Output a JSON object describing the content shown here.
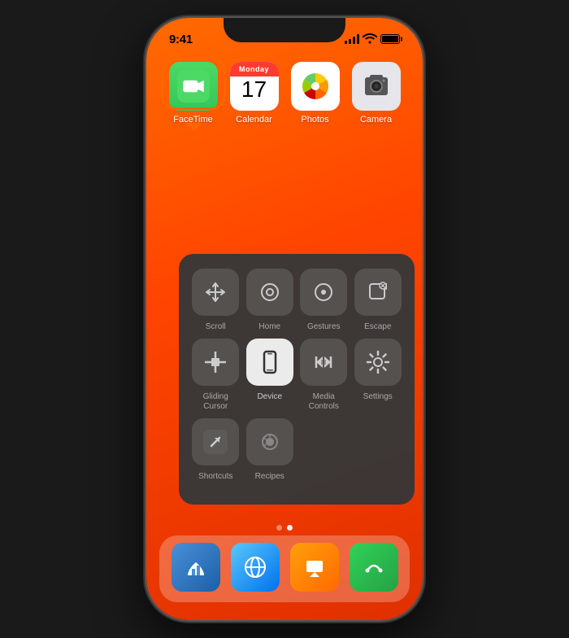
{
  "phone": {
    "status_bar": {
      "time": "9:41",
      "signal_full": true,
      "wifi": true,
      "battery_full": true
    },
    "home_screen": {
      "row1": [
        {
          "id": "facetime",
          "label": "FaceTime",
          "highlighted": true
        },
        {
          "id": "calendar",
          "label": "Calendar",
          "day": "Monday",
          "date": "17"
        },
        {
          "id": "photos",
          "label": "Photos"
        },
        {
          "id": "camera",
          "label": "Camera"
        }
      ]
    },
    "assistive_panel": {
      "row1": [
        {
          "id": "scroll",
          "label": "Scroll"
        },
        {
          "id": "home",
          "label": "Home"
        },
        {
          "id": "gestures",
          "label": "Gestures"
        },
        {
          "id": "escape",
          "label": "Escape"
        }
      ],
      "row2": [
        {
          "id": "gliding-cursor",
          "label": "Gliding\nCursor"
        },
        {
          "id": "device",
          "label": "Device",
          "highlighted": true
        },
        {
          "id": "media-controls",
          "label": "Media\nControls"
        },
        {
          "id": "settings",
          "label": "Settings"
        }
      ],
      "row3": [
        {
          "id": "shortcuts",
          "label": "Shortcuts"
        },
        {
          "id": "recipes",
          "label": "Recipes"
        }
      ]
    },
    "page_dots": [
      {
        "active": false
      },
      {
        "active": true
      }
    ]
  }
}
